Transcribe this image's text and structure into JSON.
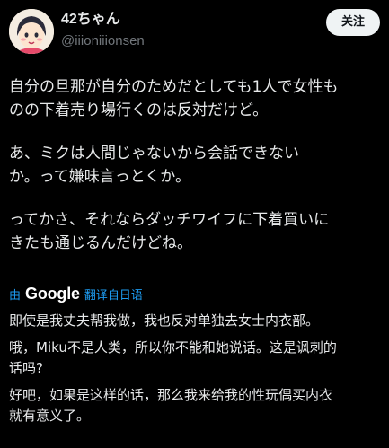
{
  "author": {
    "display_name": "42ちゃん",
    "handle": "@iiioniiionsen",
    "avatar_icon": "avatar-icon"
  },
  "follow_label": "关注",
  "tweet": {
    "paragraphs": [
      "自分の旦那が自分のためだとしても1人で女性も\nのの下着売り場行くのは反対だけど。",
      "あ、ミクは人間じゃないから会話できない\nか。って嫌味言っとくか。",
      "ってかさ、それならダッチワイフに下着買いに\nきたも通じるんだけどね。"
    ]
  },
  "translation": {
    "by_label": "由",
    "provider": "Google",
    "link_label": "翻译自日语",
    "paragraphs": [
      "即使是我丈夫帮我做，我也反对单独去女士内衣部。",
      "哦，Miku不是人类，所以你不能和她说话。这是讽刺的\n话吗?",
      "好吧，如果是这样的话，那么我来给我的性玩偶买内衣\n就有意义了。"
    ]
  },
  "colors": {
    "background": "#000000",
    "text": "#e7e9ea",
    "secondary": "#71767b",
    "link": "#1d9bf0",
    "follow_bg": "#eff3f4"
  }
}
